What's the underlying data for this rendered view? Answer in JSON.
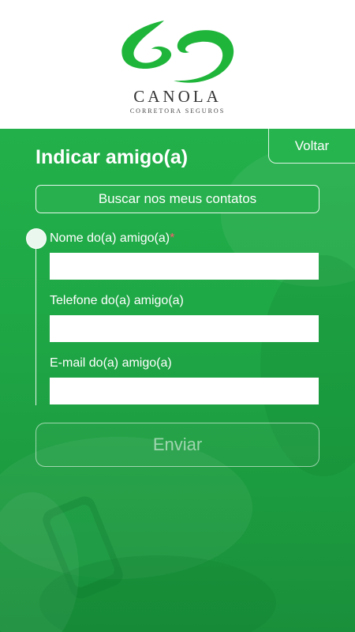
{
  "brand": {
    "name": "CANOLA",
    "subtitle": "CORRETORA SEGUROS",
    "logo_icon": "canola-swoosh-icon"
  },
  "colors": {
    "primary_green": "#22b04a",
    "dark_green": "#1a8f3b",
    "required_mark": "#ff5a6e"
  },
  "nav": {
    "back_label": "Voltar"
  },
  "page": {
    "title": "Indicar amigo(a)"
  },
  "actions": {
    "contacts_label": "Buscar nos meus contatos",
    "submit_label": "Enviar"
  },
  "form": {
    "name_label": "Nome do(a) amigo(a)",
    "required_mark": "*",
    "name_value": "",
    "phone_label": "Telefone do(a) amigo(a)",
    "phone_value": "",
    "email_label": "E-mail do(a) amigo(a)",
    "email_value": ""
  }
}
